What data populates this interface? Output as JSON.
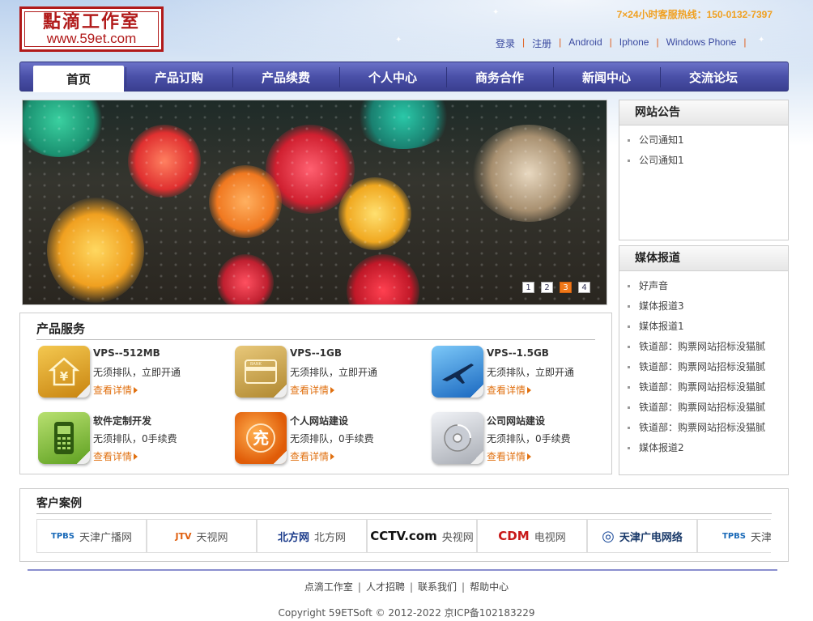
{
  "header": {
    "logo_cn": "點滴工作室",
    "logo_url": "www.59et.com",
    "hotline": "7×24小时客服热线：150-0132-7397",
    "top_links": [
      "登录",
      "注册",
      "Android",
      "Iphone",
      "Windows Phone"
    ]
  },
  "nav": {
    "items": [
      "首页",
      "产品订购",
      "产品续费",
      "个人中心",
      "商务合作",
      "新闻中心",
      "交流论坛"
    ],
    "active_index": 0
  },
  "banner": {
    "pages": [
      "1",
      "2",
      "3",
      "4"
    ],
    "current_page": "3"
  },
  "notice": {
    "title": "网站公告",
    "items": [
      "公司通知1",
      "公司通知1"
    ]
  },
  "media": {
    "title": "媒体报道",
    "items": [
      "好声音",
      "媒体报道3",
      "媒体报道1",
      "铁道部：购票网站招标没猫腻",
      "铁道部：购票网站招标没猫腻",
      "铁道部：购票网站招标没猫腻",
      "铁道部：购票网站招标没猫腻",
      "铁道部：购票网站招标没猫腻",
      "媒体报道2"
    ]
  },
  "products": {
    "title": "产品服务",
    "more_label": "查看详情",
    "items": [
      {
        "name": "VPS--512MB",
        "desc": "无须排队，立即开通",
        "icon": "house-yen-icon",
        "color": "#d8a020"
      },
      {
        "name": "VPS--1GB",
        "desc": "无须排队，立即开通",
        "icon": "bank-card-icon",
        "color": "#c8a050"
      },
      {
        "name": "VPS--1.5GB",
        "desc": "无须排队，立即开通",
        "icon": "airplane-icon",
        "color": "#2a80d0"
      },
      {
        "name": "软件定制开发",
        "desc": "无须排队，0手续费",
        "icon": "mobile-phone-icon",
        "color": "#7ab83a"
      },
      {
        "name": "个人网站建设",
        "desc": "无须排队，0手续费",
        "icon": "recharge-icon",
        "color": "#e87010"
      },
      {
        "name": "公司网站建设",
        "desc": "无须排队，0手续费",
        "icon": "disc-icon",
        "color": "#b8bcc4"
      }
    ]
  },
  "cases": {
    "title": "客户案例",
    "logos": [
      {
        "mark": "TPBS",
        "text": "天津广播网",
        "color": "#1a6ab8"
      },
      {
        "mark": "JTV",
        "text": "天视网",
        "color": "#e06010"
      },
      {
        "mark": "北方网",
        "text": "北方网",
        "color": "#1a3a8a"
      },
      {
        "mark": "CCTV.com",
        "text": "央视网",
        "color": "#111111"
      },
      {
        "mark": "CDM",
        "text": "电视网",
        "color": "#c81818"
      },
      {
        "mark": "◎",
        "text": "天津广电网络",
        "color": "#1a4a9a"
      },
      {
        "mark": "TPBS",
        "text": "天津广",
        "color": "#1a6ab8"
      }
    ]
  },
  "footer": {
    "links": [
      "点滴工作室",
      "人才招聘",
      "联系我们",
      "帮助中心"
    ],
    "copyright": "Copyright 59ETSoft © 2012-2022 京ICP备102183229"
  }
}
